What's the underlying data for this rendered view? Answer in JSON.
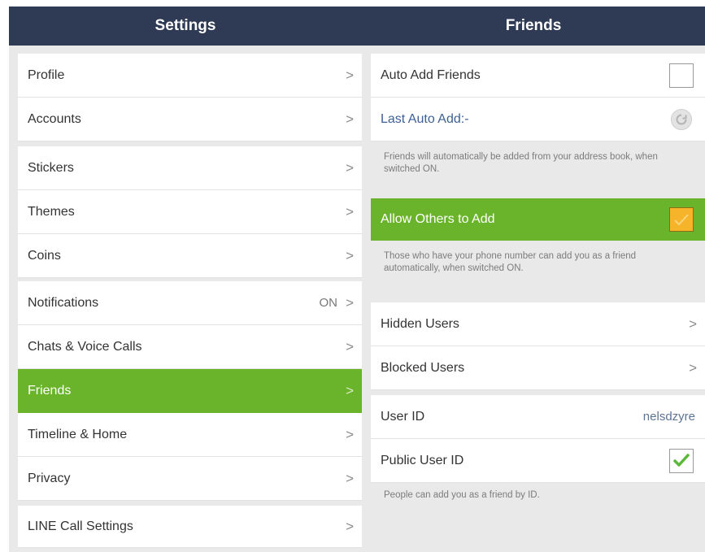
{
  "header": {
    "settings_title": "Settings",
    "friends_title": "Friends"
  },
  "settings_menu": [
    {
      "label": "Profile",
      "status": ""
    },
    {
      "label": "Accounts",
      "status": ""
    },
    {
      "label": "Stickers",
      "status": ""
    },
    {
      "label": "Themes",
      "status": ""
    },
    {
      "label": "Coins",
      "status": ""
    },
    {
      "label": "Notifications",
      "status": "ON"
    },
    {
      "label": "Chats & Voice Calls",
      "status": ""
    },
    {
      "label": "Friends",
      "status": ""
    },
    {
      "label": "Timeline & Home",
      "status": ""
    },
    {
      "label": "Privacy",
      "status": ""
    },
    {
      "label": "LINE Call Settings",
      "status": ""
    }
  ],
  "chevron": ">",
  "friends": {
    "auto_add": {
      "label": "Auto Add Friends",
      "checked": false
    },
    "last_auto_add": {
      "label": "Last Auto Add:-"
    },
    "auto_add_note": "Friends will automatically be added from your address book, when switched ON.",
    "allow_others": {
      "label": "Allow Others to Add",
      "checked": true
    },
    "allow_others_note": "Those who have your phone number can add you as a friend automatically, when switched ON.",
    "hidden_users": {
      "label": "Hidden Users"
    },
    "blocked_users": {
      "label": "Blocked Users"
    },
    "user_id": {
      "label": "User ID",
      "value": "nelsdzyre"
    },
    "public_user_id": {
      "label": "Public User ID",
      "checked": true
    },
    "public_note": "People can add you as a friend by ID."
  },
  "colors": {
    "header_bg": "#2f3b54",
    "active_green": "#6ab42b",
    "checkbox_orange": "#f5b42a",
    "check_green": "#5cb83b",
    "link_blue": "#3f6096"
  }
}
